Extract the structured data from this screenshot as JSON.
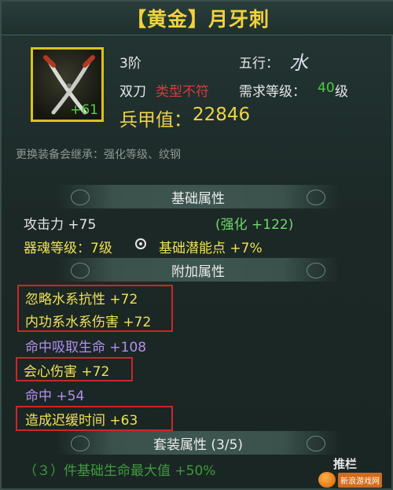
{
  "title": "【黄金】月牙刺",
  "item": {
    "icon_bonus": "+61",
    "tier": "3阶",
    "element_label": "五行：",
    "element_value": "水",
    "weapon_type": "双刀",
    "restriction": "类型不符",
    "req_level_label": "需求等级：",
    "req_level_value": "40",
    "req_level_unit": "级",
    "power_label": "兵甲值：",
    "power_value": "22846",
    "inherit_note": "更换装备会继承：强化等级、纹钢"
  },
  "sections": {
    "basic": "基础属性",
    "extra": "附加属性",
    "set": "套装属性 (3/5)"
  },
  "basic_stats": {
    "attack": "攻击力 +75",
    "enhance": "(强化 +122)",
    "soul": "器魂等级：7级",
    "potential": "基础潜能点 +7%"
  },
  "extra_stats": [
    {
      "text": "忽略水系抗性 +72",
      "color": "yellow"
    },
    {
      "text": "内功系水系伤害 +72",
      "color": "yellow"
    },
    {
      "text": "命中吸取生命 +108",
      "color": "purple"
    },
    {
      "text": "会心伤害 +72",
      "color": "yellow"
    },
    {
      "text": "命中 +54",
      "color": "purple"
    },
    {
      "text": "造成迟缓时间 +63",
      "color": "yellow"
    }
  ],
  "set_stats": {
    "line1": "（３）件基础生命最大值 +50%"
  },
  "collapse_button": "推栏",
  "watermark": "新浪游戏网",
  "colors": {
    "title": "#f2d23a",
    "highlight_border": "#d2232a",
    "green": "#4fc944",
    "purple": "#b58df0",
    "yellow": "#f0e055",
    "red": "#d83b3b"
  }
}
